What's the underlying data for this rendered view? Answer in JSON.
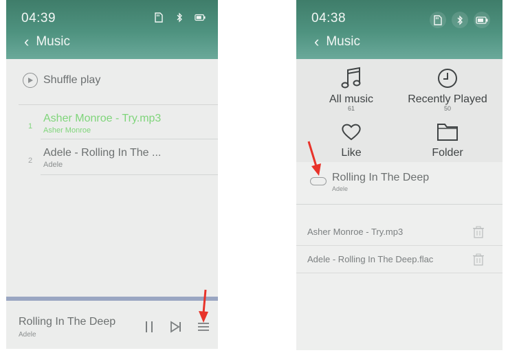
{
  "left": {
    "status": {
      "time": "04:39",
      "icons": [
        "sd-card-icon",
        "bluetooth-icon",
        "battery-icon"
      ]
    },
    "header": {
      "back_label": "Music"
    },
    "shuffle_label": "Shuffle play",
    "songs": [
      {
        "index": "1",
        "title": "Asher Monroe - Try.mp3",
        "artist": "Asher Monroe",
        "active": true
      },
      {
        "index": "2",
        "title": "Adele - Rolling In The ...",
        "artist": "Adele",
        "active": false
      }
    ],
    "now_playing": {
      "title": "Rolling In The Deep",
      "artist": "Adele"
    },
    "controls": [
      "pause-icon",
      "next-track-icon",
      "playlist-icon"
    ]
  },
  "right": {
    "status": {
      "time": "04:38",
      "icons": [
        "sd-card-icon",
        "bluetooth-icon",
        "battery-icon"
      ]
    },
    "header": {
      "back_label": "Music"
    },
    "categories": [
      {
        "label": "All music",
        "count": "61",
        "icon": "music-note-icon"
      },
      {
        "label": "Recently Played",
        "count": "50",
        "icon": "clock-icon"
      },
      {
        "label": "Like",
        "count": "",
        "icon": "heart-icon"
      },
      {
        "label": "Folder",
        "count": "",
        "icon": "folder-icon"
      }
    ],
    "now_playing": {
      "title": "Rolling In The Deep",
      "artist": "Adele"
    },
    "queue": [
      {
        "label": "Asher Monroe - Try.mp3"
      },
      {
        "label": "Adele - Rolling In The Deep.flac"
      }
    ]
  },
  "colors": {
    "header": "#4f9380",
    "active_song": "#7fd57a",
    "progress": "#9aa6c2",
    "arrow": "#e8332a"
  }
}
